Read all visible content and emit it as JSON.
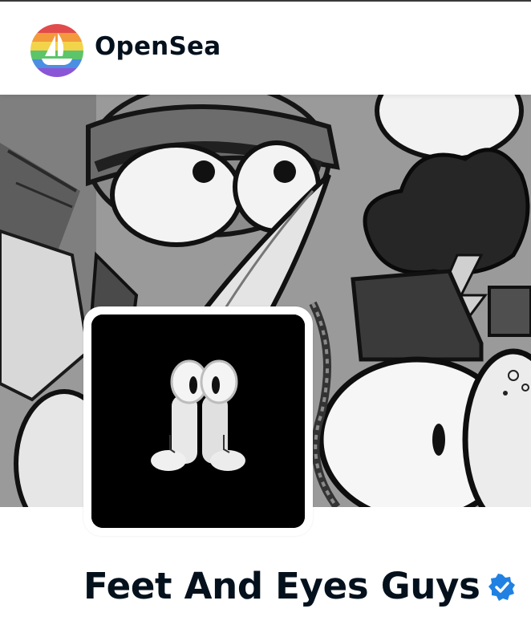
{
  "header": {
    "brand_name": "OpenSea",
    "logo_icon": "opensea-sailboat-rainbow-icon"
  },
  "banner": {
    "image": "collection-banner-illustration-grayscale"
  },
  "collection": {
    "name": "Feet And Eyes Guys",
    "avatar": "feet-and-eyes-guys-avatar",
    "verified_icon": "verified-badge-icon"
  },
  "colors": {
    "text_primary": "#04111d",
    "verified_blue": "#2081e2",
    "page_background": "#ffffff"
  }
}
